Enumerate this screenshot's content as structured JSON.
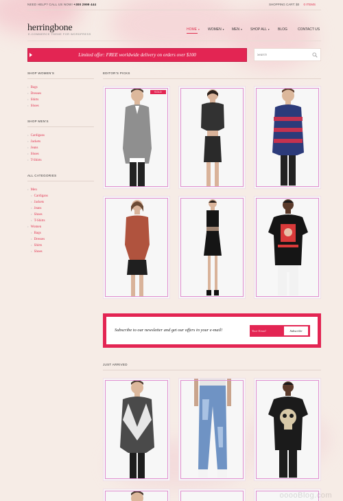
{
  "topbar": {
    "help_label": "NEED HELP? CALL US NOW!",
    "phone": "+300 2999 444",
    "cart_label": "SHOPPING CART: $0",
    "cart_items": "0 ITEMS"
  },
  "header": {
    "logo": "herringbone",
    "tagline": "E-COMMERCE THEME FOR WORDPRESS",
    "nav": [
      {
        "label": "HOME",
        "has_dropdown": true,
        "active": true
      },
      {
        "label": "WOMEN",
        "has_dropdown": true
      },
      {
        "label": "MEN",
        "has_dropdown": true
      },
      {
        "label": "SHOP ALL",
        "has_dropdown": true
      },
      {
        "label": "BLOG",
        "has_dropdown": false
      },
      {
        "label": "CONTACT US",
        "has_dropdown": false
      }
    ]
  },
  "promo": {
    "text": "Limited offer: FREE worldwide delivery on orders over $100"
  },
  "search": {
    "placeholder": "Search",
    "icon": "search-icon"
  },
  "sidebar": {
    "shop_women": {
      "heading": "SHOP WOMEN'S",
      "items": [
        "Bags",
        "Dresses",
        "Shirts",
        "Shoes"
      ]
    },
    "shop_men": {
      "heading": "SHOP MEN'S",
      "items": [
        "Cardigans",
        "Jackets",
        "Jeans",
        "Shoes",
        "T-Shirts"
      ]
    },
    "all_categories": {
      "heading": "ALL CATEGORIES",
      "items": [
        {
          "label": "Men",
          "level": 0
        },
        {
          "label": "Cardigans",
          "level": 1
        },
        {
          "label": "Jackets",
          "level": 1
        },
        {
          "label": "Jeans",
          "level": 1
        },
        {
          "label": "Shoes",
          "level": 1
        },
        {
          "label": "T-Shirts",
          "level": 1
        },
        {
          "label": "Women",
          "level": 0
        },
        {
          "label": "Bags",
          "level": 1
        },
        {
          "label": "Dresses",
          "level": 1
        },
        {
          "label": "Shirts",
          "level": 1
        },
        {
          "label": "Shoes",
          "level": 1
        }
      ]
    }
  },
  "editors_picks": {
    "heading": "EDITOR'S PICKS",
    "sold_badge": "SOLD",
    "products": [
      {
        "name": "grey cardigan",
        "badge": true
      },
      {
        "name": "black lace top and skirt"
      },
      {
        "name": "striped cardigan"
      },
      {
        "name": "red printed top with black shorts"
      },
      {
        "name": "black mesh dress"
      },
      {
        "name": "black printed t-shirt"
      }
    ]
  },
  "newsletter": {
    "text": "Subscribe to our newsletter and get our offers in your e-mail!",
    "email_placeholder": "Your Email",
    "button_label": "Subscribe"
  },
  "just_arrived": {
    "heading": "JUST ARRIVED",
    "products": [
      {
        "name": "geometric print sweatshirt"
      },
      {
        "name": "distressed blue jeans"
      },
      {
        "name": "skull print t-shirt"
      }
    ]
  },
  "watermark": "ooooBlog.com",
  "colors": {
    "accent": "#e32553",
    "background": "#f6ece6",
    "link": "#e0304f"
  }
}
